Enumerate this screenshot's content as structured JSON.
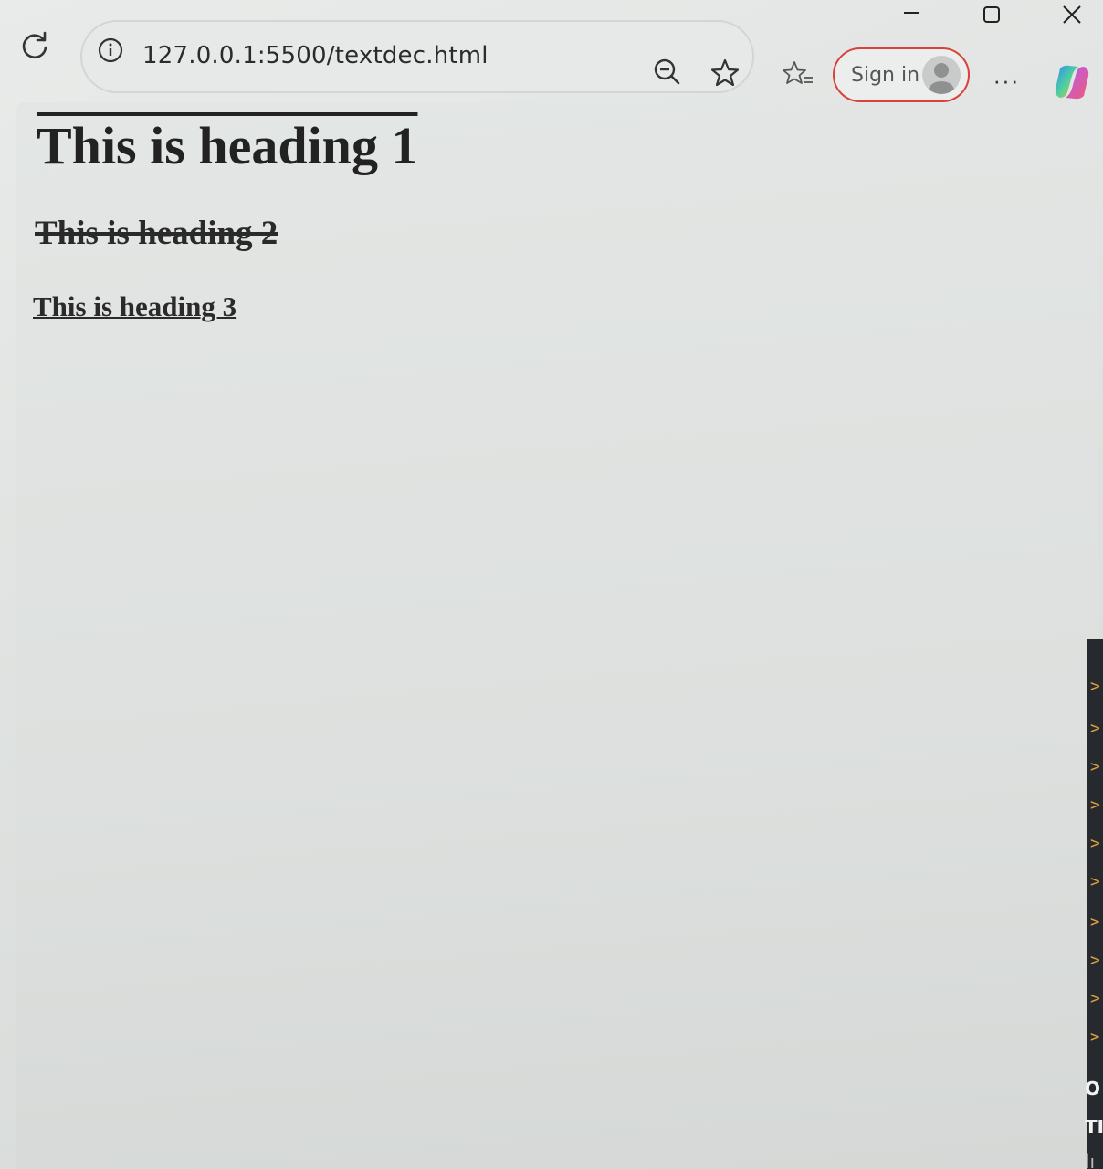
{
  "browser": {
    "url": "127.0.0.1:5500/textdec.html",
    "signin_label": "Sign in",
    "more_label": "···",
    "icons": {
      "reload": "reload-icon",
      "site_info": "info-icon",
      "zoom": "zoom-out-icon",
      "favorite": "star-icon",
      "favorites": "favorites-icon",
      "profile": "avatar",
      "copilot": "copilot-icon",
      "minimize": "minimize-icon",
      "maximize": "maximize-icon",
      "close": "close-icon"
    },
    "signin_border_color": "#d9423a"
  },
  "page": {
    "heading1": "This is heading 1",
    "heading2": "This is heading 2",
    "heading3": "This is heading 3"
  },
  "side_window": {
    "text_lines": [
      "O",
      "TI",
      "lı"
    ]
  }
}
